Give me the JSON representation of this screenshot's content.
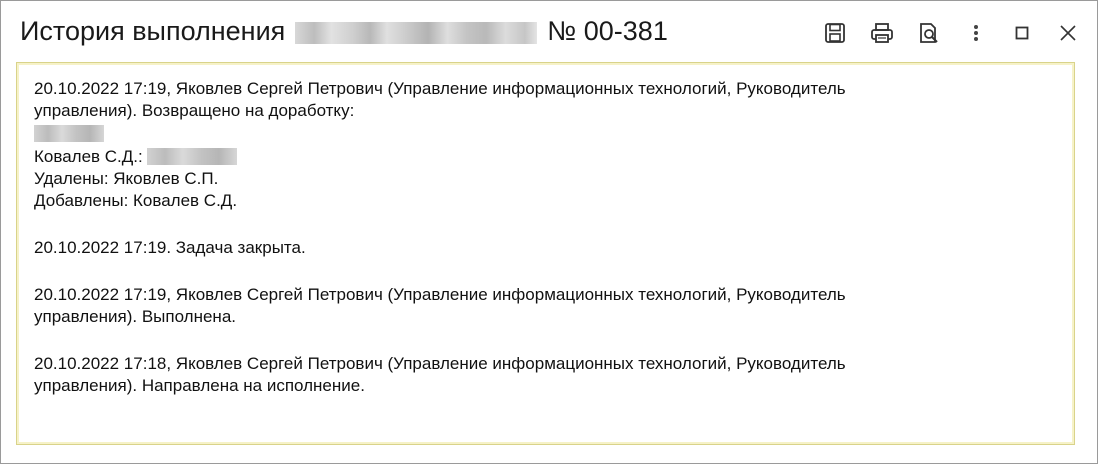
{
  "window": {
    "title_prefix": "История выполнения",
    "title_suffix": "№ 00-381"
  },
  "toolbar": {
    "save": "save-icon",
    "print": "printer-icon",
    "preview": "print-preview-icon",
    "more": "more-vertical-icon",
    "maximize": "maximize-icon",
    "close": "close-icon"
  },
  "history": [
    {
      "lines": [
        "20.10.2022 17:19, Яковлев Сергей Петрович (Управление информационных технологий, Руководитель",
        "управления). Возвращено на доработку:"
      ],
      "extra": {
        "field_label": "Ковалев С.Д.:",
        "removed": "Удалены: Яковлев С.П.",
        "added": "Добавлены: Ковалев С.Д."
      }
    },
    {
      "lines": [
        "20.10.2022 17:19. Задача закрыта."
      ]
    },
    {
      "lines": [
        "20.10.2022 17:19, Яковлев Сергей Петрович (Управление информационных технологий, Руководитель",
        "управления). Выполнена."
      ]
    },
    {
      "lines": [
        "20.10.2022 17:18, Яковлев Сергей Петрович (Управление информационных технологий, Руководитель",
        "управления). Направлена на исполнение."
      ]
    }
  ],
  "colors": {
    "content_border": "#d9d38a",
    "window_border": "#9a9a9a"
  }
}
